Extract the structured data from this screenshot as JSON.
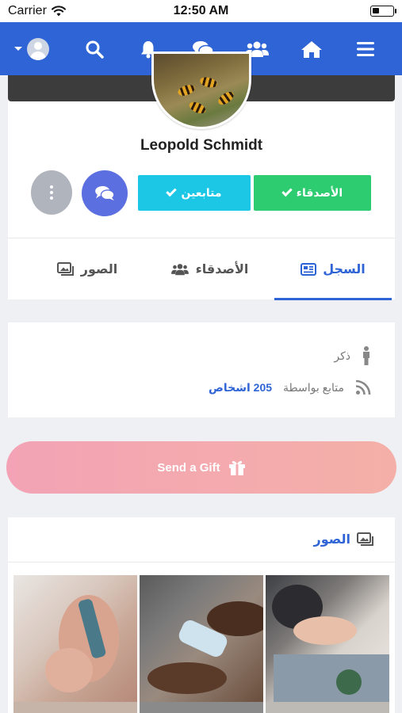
{
  "status_bar": {
    "carrier": "Carrier",
    "time": "12:50 AM"
  },
  "navbar": {
    "icons": [
      "menu-icon",
      "home-icon",
      "groups-icon",
      "chat-icon",
      "bell-icon",
      "search-icon",
      "avatar"
    ]
  },
  "profile": {
    "name": "Leopold Schmidt",
    "friends_button": "الأصدقاء",
    "following_button": "متابعين",
    "tabs": {
      "timeline": "السجل",
      "friends": "الأصدقاء",
      "photos": "الصور"
    }
  },
  "info": {
    "gender": "ذكر",
    "followed_by_prefix": "متابع بواسطة",
    "followers_count": "205 اشخاص"
  },
  "gift": {
    "label": "Send a Gift"
  },
  "photos": {
    "title": "الصور"
  },
  "colors": {
    "primary": "#2f64d6",
    "friends_green": "#2ecc71",
    "following_cyan": "#1cc7e6",
    "message_purple": "#5b6fe0",
    "gift_gradient_start": "#f3a3b5",
    "gift_gradient_end": "#f4b0a8"
  }
}
